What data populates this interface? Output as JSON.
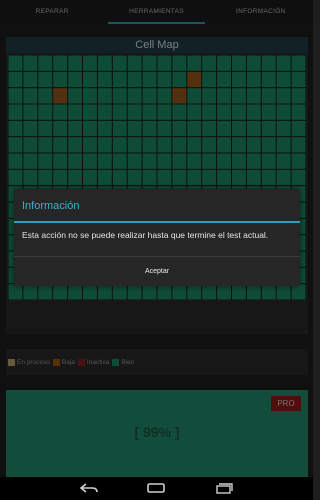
{
  "tabs": [
    {
      "label": "REPARAR",
      "active": false
    },
    {
      "label": "HERRAMIENTAS",
      "active": true
    },
    {
      "label": "INFORMACIÓN",
      "active": false
    }
  ],
  "cell_map": {
    "title": "Cell Map",
    "rows": 15,
    "cols": 20,
    "colors": {
      "good": "#1c8a67",
      "low": "#9a5a1a"
    },
    "low_cells": [
      [
        1,
        12
      ],
      [
        2,
        3
      ],
      [
        2,
        11
      ]
    ]
  },
  "dialog": {
    "title": "Información",
    "message": "Esta acción no se puede realizar hasta que termine el test actual.",
    "button": "Aceptar"
  },
  "legend": [
    {
      "label": "En proceso",
      "color": "#b8a46a"
    },
    {
      "label": "Baja",
      "color": "#a35a12"
    },
    {
      "label": "Inactiva",
      "color": "#8a2121"
    },
    {
      "label": "Bien",
      "color": "#1c8a67"
    }
  ],
  "progress": {
    "text": "[ 99% ]",
    "badge": "PRO"
  }
}
